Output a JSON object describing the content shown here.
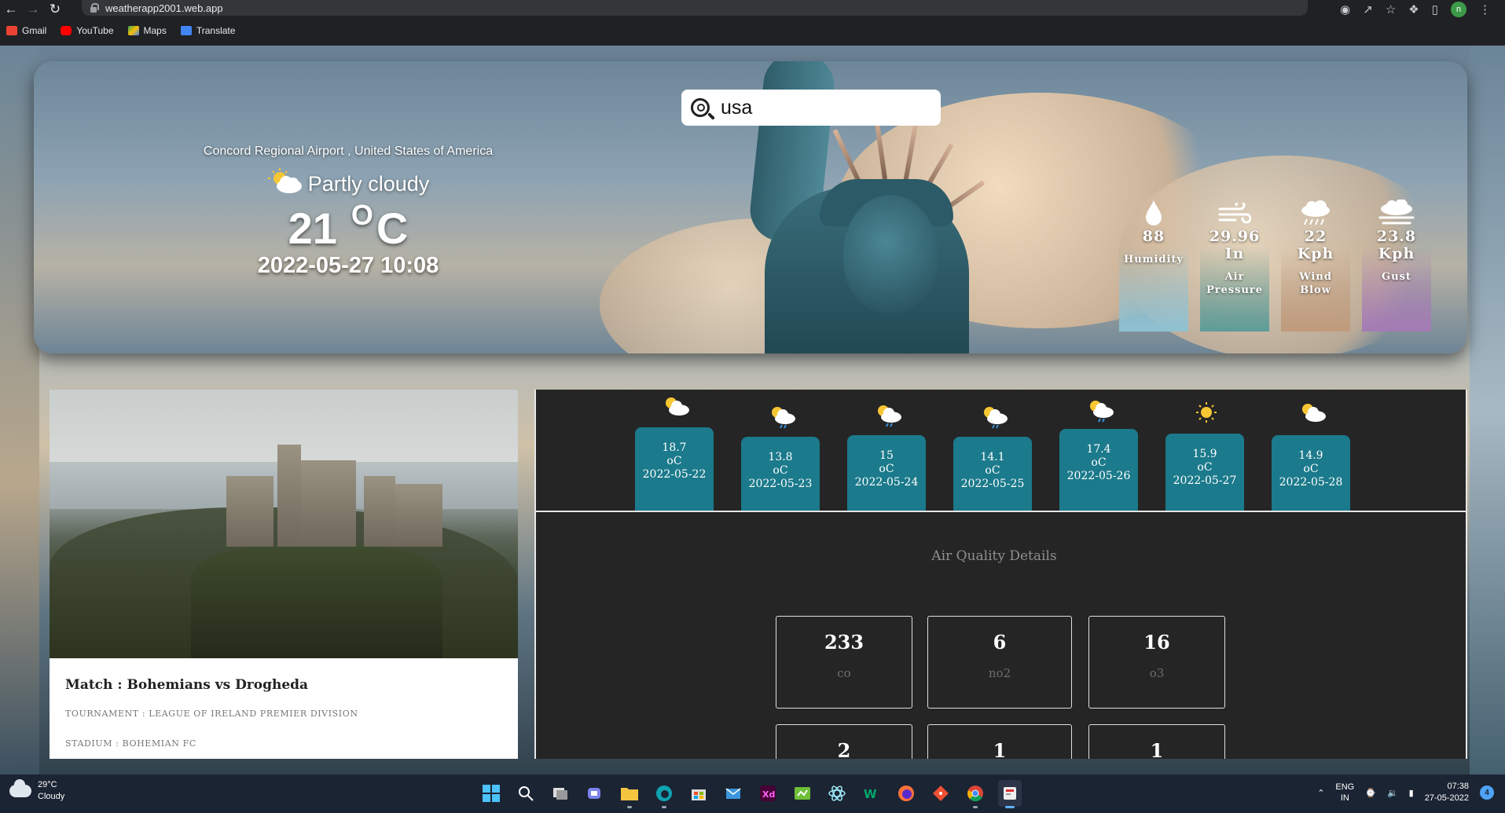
{
  "browser": {
    "url": "weatherapp2001.web.app",
    "profile_initial": "n",
    "bookmarks": [
      {
        "label": "Gmail",
        "color": "#ea4335"
      },
      {
        "label": "YouTube",
        "color": "#ff0000"
      },
      {
        "label": "Maps",
        "color": "#34a853"
      },
      {
        "label": "Translate",
        "color": "#4285f4"
      }
    ]
  },
  "search": {
    "value": "usa"
  },
  "current": {
    "location": "Concord Regional Airport , United States of America",
    "condition": "Partly cloudy",
    "temp": "21",
    "degree_symbol": "O",
    "unit": "C",
    "datetime": "2022-05-27 10:08"
  },
  "stats": [
    {
      "icon": "droplet-icon",
      "value": "88",
      "unit": "",
      "label": "Humidity",
      "color": "#7fb4c7"
    },
    {
      "icon": "wind-icon",
      "value": "29.96",
      "unit": "In",
      "label": "Air Pressure",
      "color": "#5e9c98"
    },
    {
      "icon": "rain-cloud-icon",
      "value": "22",
      "unit": "Kph",
      "label": "Wind Blow",
      "color": "#b99477"
    },
    {
      "icon": "fog-cloud-icon",
      "value": "23.8",
      "unit": "Kph",
      "label": "Gust",
      "color": "#a57bb5"
    }
  ],
  "forecast": [
    {
      "temp": "18.7",
      "unit": "oC",
      "date": "2022-05-22",
      "icon": "partly-cloudy-icon"
    },
    {
      "temp": "13.8",
      "unit": "oC",
      "date": "2022-05-23",
      "icon": "rain-sun-icon"
    },
    {
      "temp": "15",
      "unit": "oC",
      "date": "2022-05-24",
      "icon": "rain-sun-icon"
    },
    {
      "temp": "14.1",
      "unit": "oC",
      "date": "2022-05-25",
      "icon": "rain-sun-icon"
    },
    {
      "temp": "17.4",
      "unit": "oC",
      "date": "2022-05-26",
      "icon": "rain-sun-icon"
    },
    {
      "temp": "15.9",
      "unit": "oC",
      "date": "2022-05-27",
      "icon": "sun-icon"
    },
    {
      "temp": "14.9",
      "unit": "oC",
      "date": "2022-05-28",
      "icon": "partly-cloudy-icon"
    }
  ],
  "news": {
    "title": "Match : Bohemians vs Drogheda",
    "tournament": "TOURNAMENT : LEAGUE OF IRELAND PREMIER DIVISION",
    "stadium": "STADIUM : BOHEMIAN FC"
  },
  "air_quality": {
    "title": "Air Quality Details",
    "items": [
      {
        "value": "233",
        "label": "co"
      },
      {
        "value": "6",
        "label": "no2"
      },
      {
        "value": "16",
        "label": "o3"
      },
      {
        "value": "2",
        "label": ""
      },
      {
        "value": "1",
        "label": ""
      },
      {
        "value": "1",
        "label": ""
      }
    ]
  },
  "taskbar": {
    "weather_temp": "29°C",
    "weather_desc": "Cloudy",
    "lang_top": "ENG",
    "lang_bottom": "IN",
    "time": "07:38",
    "date": "27-05-2022",
    "notifications": "4"
  }
}
